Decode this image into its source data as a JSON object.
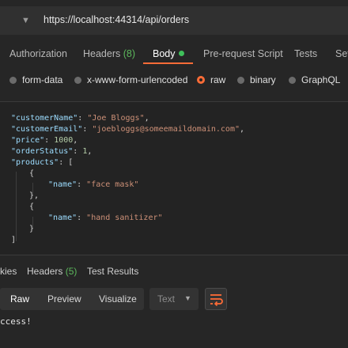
{
  "request": {
    "url": "https://localhost:44314/api/orders"
  },
  "tabs": [
    {
      "label": "Authorization"
    },
    {
      "label": "Headers",
      "count": "(8)"
    },
    {
      "label": "Body"
    },
    {
      "label": "Pre-request Script"
    },
    {
      "label": "Tests"
    },
    {
      "label": "Set"
    }
  ],
  "body_types": [
    {
      "label": "form-data"
    },
    {
      "label": "x-www-form-urlencoded"
    },
    {
      "label": "raw",
      "selected": true
    },
    {
      "label": "binary"
    },
    {
      "label": "GraphQL"
    }
  ],
  "code_lines": [
    "\"customerName\": \"Joe Bloggs\",",
    "\"customerEmail\": \"joebloggs@someemaildomain.com\",",
    "\"price\": 1000,",
    "\"orderStatus\": 1,",
    "\"products\": [",
    "{",
    "\"name\": \"face mask\"",
    "},",
    "{",
    "\"name\": \"hand sanitizer\"",
    "}",
    "]"
  ],
  "response_tabs": [
    {
      "label": "kies"
    },
    {
      "label": "Headers",
      "count": "(5)"
    },
    {
      "label": "Test Results"
    }
  ],
  "toolbar": {
    "raw": "Raw",
    "preview": "Preview",
    "visualize": "Visualize",
    "format": "Text"
  },
  "response": {
    "text": "ccess!"
  },
  "colors": {
    "accent": "#ff6c37",
    "success": "#5cb85c"
  }
}
